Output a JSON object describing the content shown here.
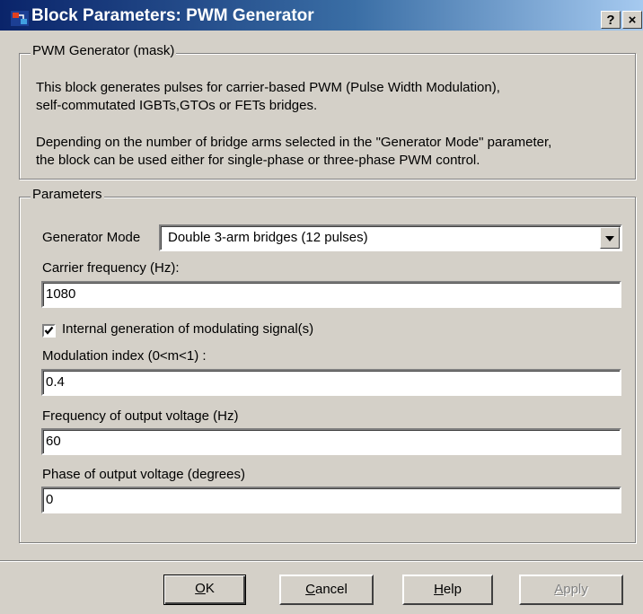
{
  "window": {
    "title": "Block Parameters: PWM Generator",
    "help_button": "?",
    "close_button": "×"
  },
  "mask": {
    "legend": "PWM Generator (mask)",
    "description_line1": "This block generates pulses for carrier-based PWM (Pulse Width Modulation),",
    "description_line2": "self-commutated IGBTs,GTOs or FETs bridges.",
    "description_line3": "Depending on the number of bridge arms selected in the \"Generator Mode\" parameter,",
    "description_line4": "the block can be used either for single-phase or three-phase PWM control."
  },
  "parameters": {
    "legend": "Parameters",
    "generator_mode_label": "Generator Mode",
    "generator_mode_value": "Double 3-arm  bridges (12 pulses)",
    "carrier_frequency_label": "Carrier frequency (Hz):",
    "carrier_frequency_value": "1080",
    "internal_generation_label": "Internal generation of modulating signal(s)",
    "internal_generation_checked": true,
    "modulation_index_label": "Modulation index  (0<m<1) :",
    "modulation_index_value": "0.4",
    "output_frequency_label": "Frequency of output voltage (Hz)",
    "output_frequency_value": "60",
    "output_phase_label": "Phase of output voltage (degrees)",
    "output_phase_value": "0"
  },
  "buttons": {
    "ok_mnemonic": "O",
    "ok_rest": "K",
    "cancel_mnemonic": "C",
    "cancel_rest": "ancel",
    "help_mnemonic": "H",
    "help_rest": "elp",
    "apply_mnemonic": "A",
    "apply_rest": "pply"
  },
  "colors": {
    "dialog_bg": "#d4d0c8",
    "titlebar_start": "#0a246a",
    "titlebar_end": "#a6caf0"
  }
}
